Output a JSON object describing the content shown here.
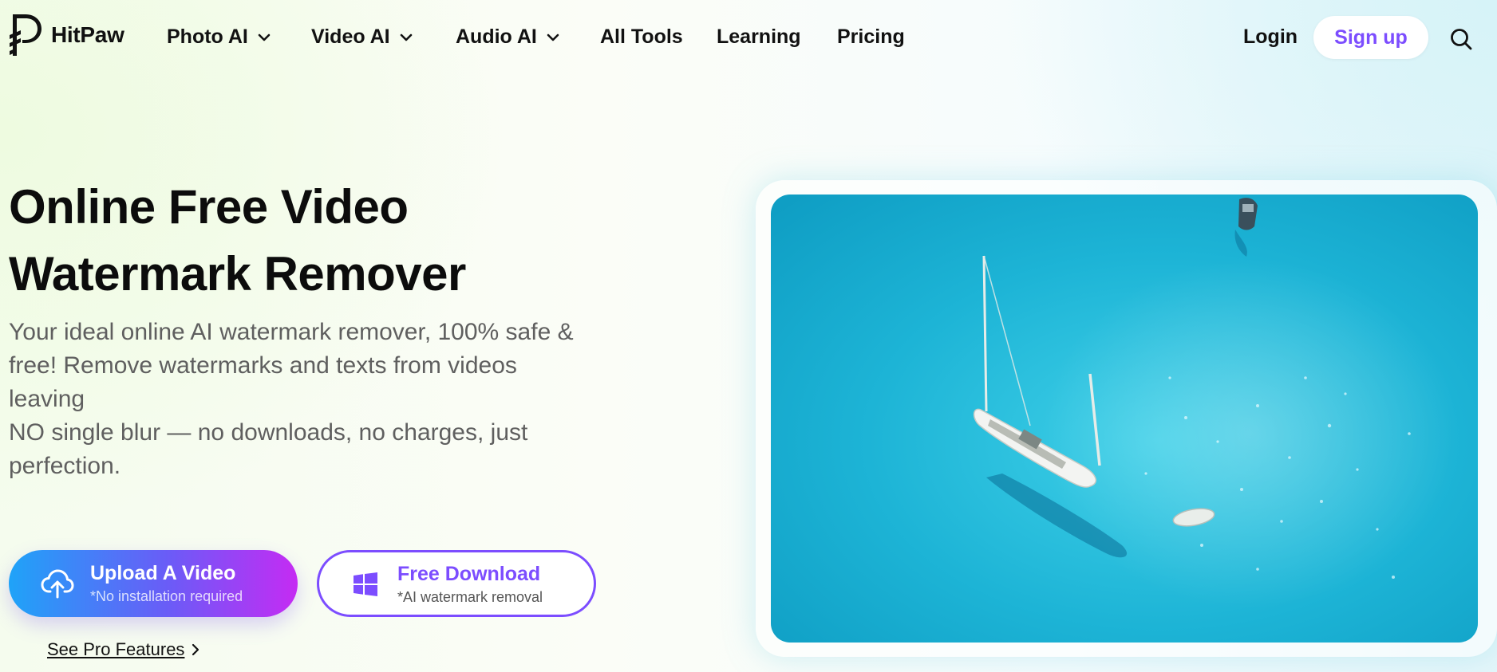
{
  "header": {
    "brand": "HitPaw",
    "nav": [
      {
        "label": "Photo AI",
        "has_dropdown": true
      },
      {
        "label": "Video AI",
        "has_dropdown": true
      },
      {
        "label": "Audio AI",
        "has_dropdown": true
      },
      {
        "label": "All Tools",
        "has_dropdown": false
      },
      {
        "label": "Learning",
        "has_dropdown": false
      },
      {
        "label": "Pricing",
        "has_dropdown": false
      }
    ],
    "login": "Login",
    "signup": "Sign up",
    "search_icon": "search-icon"
  },
  "hero": {
    "title_line1": "Online Free Video",
    "title_line2": "Watermark Remover",
    "desc_line1": "Your ideal online AI watermark remover, 100% safe &",
    "desc_line2": "free! Remove watermarks and texts from videos",
    "desc_line3": "leaving",
    "desc_line4": "NO single blur — no downloads, no charges, just",
    "desc_line5": "perfection."
  },
  "cta": {
    "upload_label": "Upload A Video",
    "upload_sub": "*No installation required",
    "upload_icon": "cloud-upload-icon",
    "download_label": "Free Download",
    "download_sub": "*AI watermark removal",
    "download_icon": "windows-icon",
    "pro_link": "See Pro Features"
  },
  "colors": {
    "accent": "#7c4dff",
    "gradient_start": "#1fa3f8",
    "gradient_end": "#c52bf3",
    "sea": "#1fb7d6"
  }
}
